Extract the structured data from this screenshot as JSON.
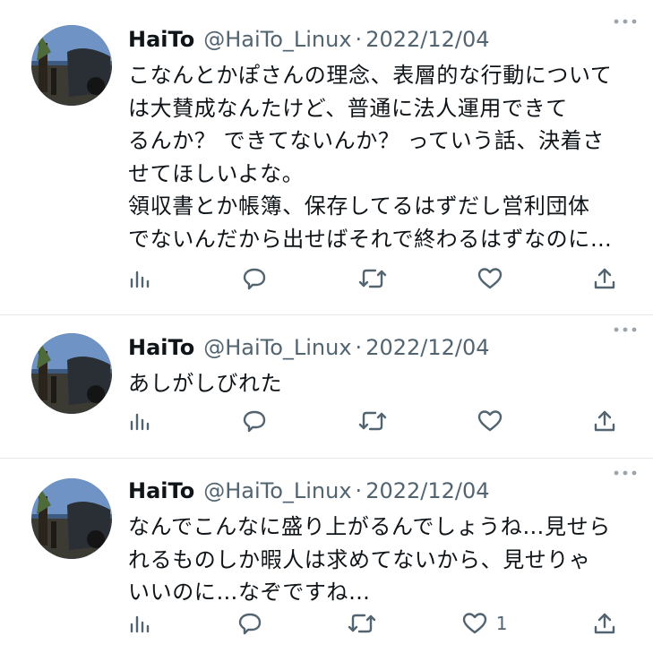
{
  "tweets": [
    {
      "author_name": "HaiTo",
      "handle": "@HaiTo_Linux",
      "separator": "·",
      "date": "2022/12/04",
      "text": "こなんとかぽさんの理念、表層的な行動について\nは大賛成なんたけど、普通に法人運用できて\nるんか？ できてないんか？ っていう話、決着さ\nせてほしいよな。\n領収書とか帳簿、保存してるはずだし営利団体\nでないんだから出せばそれで終わるはずなのに…",
      "like_count": ""
    },
    {
      "author_name": "HaiTo",
      "handle": "@HaiTo_Linux",
      "separator": "·",
      "date": "2022/12/04",
      "text": "あしがしびれた",
      "like_count": ""
    },
    {
      "author_name": "HaiTo",
      "handle": "@HaiTo_Linux",
      "separator": "·",
      "date": "2022/12/04",
      "text": "なんでこんなに盛り上がるんでしょうね…見せら\nれるものしか暇人は求めてないから、見せりゃ\nいいのに…なぞですね…",
      "like_count": "1"
    }
  ],
  "icons": {
    "more": "more-dots-icon",
    "views": "views-bar-chart-icon",
    "reply": "reply-bubble-icon",
    "retweet": "retweet-icon",
    "like": "heart-icon",
    "share": "share-upload-icon"
  },
  "colors": {
    "text": "#0f1419",
    "secondary": "#536471",
    "divider": "#e8e8e8",
    "background": "#ffffff"
  }
}
